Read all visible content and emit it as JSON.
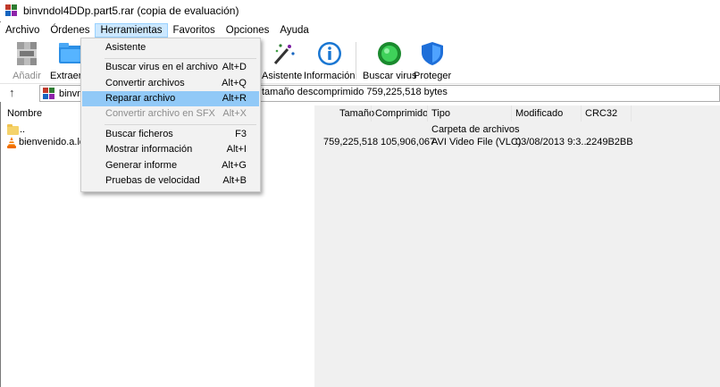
{
  "window": {
    "title": "binvndol4DDp.part5.rar (copia de evaluación)"
  },
  "menubar": {
    "items": [
      "Archivo",
      "Órdenes",
      "Herramientas",
      "Favoritos",
      "Opciones",
      "Ayuda"
    ]
  },
  "toolbar": {
    "buttons": [
      {
        "label": "Añadir",
        "icon": "add-archive-icon",
        "disabled": true
      },
      {
        "label": "Extraer e",
        "icon": "extract-folder-icon"
      },
      {
        "label": "Asistente",
        "icon": "wizard-wand-icon"
      },
      {
        "label": "Información",
        "icon": "info-icon"
      },
      {
        "label": "Buscar virus",
        "icon": "virus-scan-icon"
      },
      {
        "label": "Proteger",
        "icon": "shield-icon"
      }
    ]
  },
  "address": {
    "path_fragment": "binvn",
    "description": "tamaño descomprimido 759,225,518 bytes"
  },
  "columns": {
    "nombre": "Nombre",
    "tamano": "Tamaño",
    "comprimido": "Comprimido",
    "tipo": "Tipo",
    "modificado": "Modificado",
    "crc": "CRC32"
  },
  "rows": [
    {
      "name": "..",
      "size": "",
      "packed": "",
      "type": "Carpeta de archivos",
      "modified": "",
      "crc": "",
      "icon": "folder-icon"
    },
    {
      "name": "bienvenido.a.los.",
      "size": "759,225,518",
      "packed": "105,906,067",
      "type": "AVI Video File (VLC)",
      "modified": "03/08/2013 9:3...",
      "crc": "2249B2BB",
      "icon": "vlc-icon"
    }
  ],
  "dropdown": {
    "items": [
      {
        "label": "Asistente",
        "shortcut": ""
      },
      {
        "label": "Buscar virus en el archivo",
        "shortcut": "Alt+D"
      },
      {
        "label": "Convertir archivos",
        "shortcut": "Alt+Q"
      },
      {
        "label": "Reparar archivo",
        "shortcut": "Alt+R"
      },
      {
        "label": "Convertir archivo en SFX",
        "shortcut": "Alt+X"
      },
      {
        "label": "Buscar ficheros",
        "shortcut": "F3"
      },
      {
        "label": "Mostrar información",
        "shortcut": "Alt+I"
      },
      {
        "label": "Generar informe",
        "shortcut": "Alt+G"
      },
      {
        "label": "Pruebas de velocidad",
        "shortcut": "Alt+B"
      }
    ],
    "highlighted": "Reparar archivo",
    "disabled": "Convertir archivo en SFX"
  },
  "colors": {
    "menu_highlight": "#91c9f7",
    "menu_active": "#cce8ff",
    "pane_background": "#f0f0f0"
  }
}
